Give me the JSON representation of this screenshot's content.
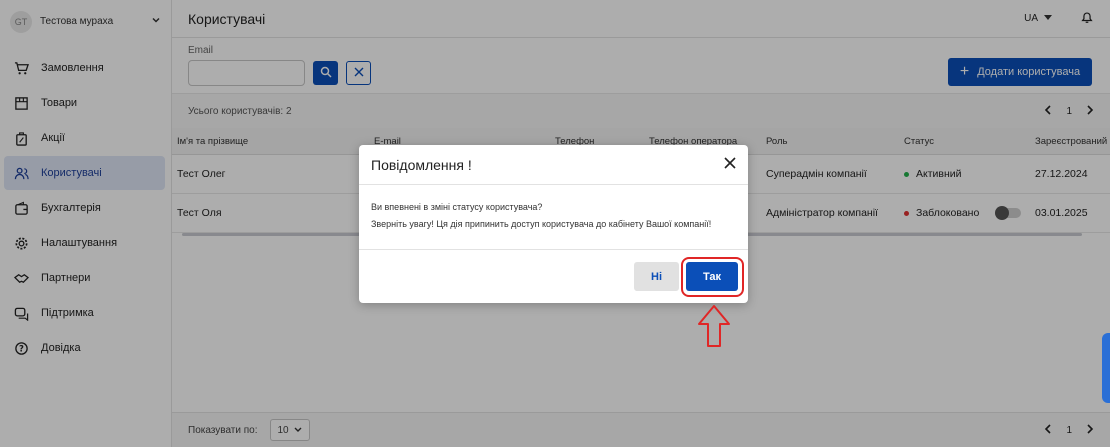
{
  "sidebar": {
    "avatar_initials": "GT",
    "company_name": "Тестова мураха",
    "items": [
      {
        "label": "Замовлення",
        "icon": "cart-icon"
      },
      {
        "label": "Товари",
        "icon": "box-icon"
      },
      {
        "label": "Акції",
        "icon": "discount-icon"
      },
      {
        "label": "Користувачі",
        "icon": "users-icon",
        "active": true
      },
      {
        "label": "Бухгалтерія",
        "icon": "wallet-icon"
      },
      {
        "label": "Налаштування",
        "icon": "gear-icon"
      },
      {
        "label": "Партнери",
        "icon": "handshake-icon"
      },
      {
        "label": "Підтримка",
        "icon": "chat-icon"
      },
      {
        "label": "Довідка",
        "icon": "help-icon"
      }
    ]
  },
  "header": {
    "title": "Користувачі",
    "lang": "UA"
  },
  "filter": {
    "label": "Email",
    "placeholder": "",
    "add_button": "Додати користувача"
  },
  "summary": {
    "count_text": "Усього користувачів: 2",
    "page": "1"
  },
  "table": {
    "columns": [
      "Ім'я та прізвище",
      "E-mail",
      "Телефон",
      "Телефон оператора",
      "Роль",
      "Статус",
      "Зареєстрований"
    ],
    "rows": [
      {
        "name": "Тест Олег",
        "role": "Суперадмін компанії",
        "status": "Активний",
        "date": "27.12.2024"
      },
      {
        "name": "Тест Оля",
        "role": "Адміністратор компанії",
        "status": "Заблоковано",
        "date": "03.01.2025"
      }
    ]
  },
  "footer": {
    "per_page_label": "Показувати по:",
    "per_page_value": "10",
    "page": "1"
  },
  "modal": {
    "title": "Повідомлення !",
    "line1": "Ви впевнені в зміні статусу користувача?",
    "line2": "Зверніть увагу! Ця дія припинить доступ користувача до кабінету Вашої компанії!",
    "no_label": "Ні",
    "yes_label": "Так"
  },
  "colors": {
    "primary": "#0b4fb8",
    "active_status": "#22b14c",
    "blocked_status": "#e03131",
    "highlight": "#e02626"
  }
}
